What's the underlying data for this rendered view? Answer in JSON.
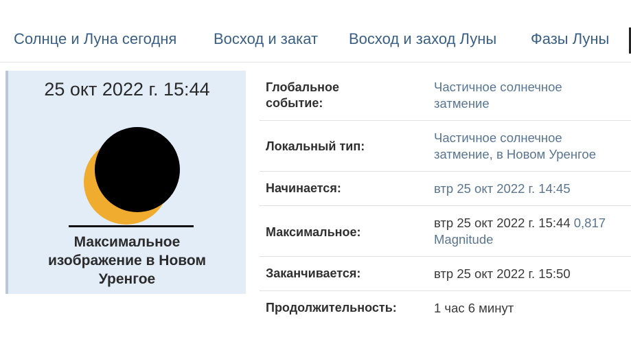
{
  "nav": {
    "items": [
      {
        "label": "Солнце и Луна сегодня"
      },
      {
        "label": "Восход и закат"
      },
      {
        "label": "Восход и заход Луны"
      },
      {
        "label": "Фазы Луны"
      }
    ]
  },
  "eclipse": {
    "date_time": "25 окт 2022 г. 15:44",
    "caption_line1": "Максимальное",
    "caption_line2": "изображение в Новом",
    "caption_line3": "Уренгое",
    "colors": {
      "sun": "#f0ac2f",
      "moon": "#000000",
      "horizon": "#111111",
      "panel_bg": "#e3edf8"
    }
  },
  "details": {
    "global_event": {
      "label_line1": "Глобальное",
      "label_line2": "событие:",
      "value_line1": "Частичное солнечное",
      "value_line2": "затмение"
    },
    "local_type": {
      "label": "Локальный тип:",
      "value_line1": "Частичное солнечное",
      "value_line2": "затмение, в Новом Уренгое"
    },
    "begins": {
      "label": "Начинается:",
      "value": "втр 25 окт 2022 г. 14:45"
    },
    "maximum": {
      "label": "Максимальное:",
      "value_time": "втр 25 окт 2022 г. 15:44",
      "value_magnitude": "0,817",
      "value_magnitude_label": "Magnitude"
    },
    "ends": {
      "label": "Заканчивается:",
      "value": "втр 25 окт 2022 г. 15:50"
    },
    "duration": {
      "label": "Продолжительность:",
      "value": "1 час 6 минут"
    }
  }
}
